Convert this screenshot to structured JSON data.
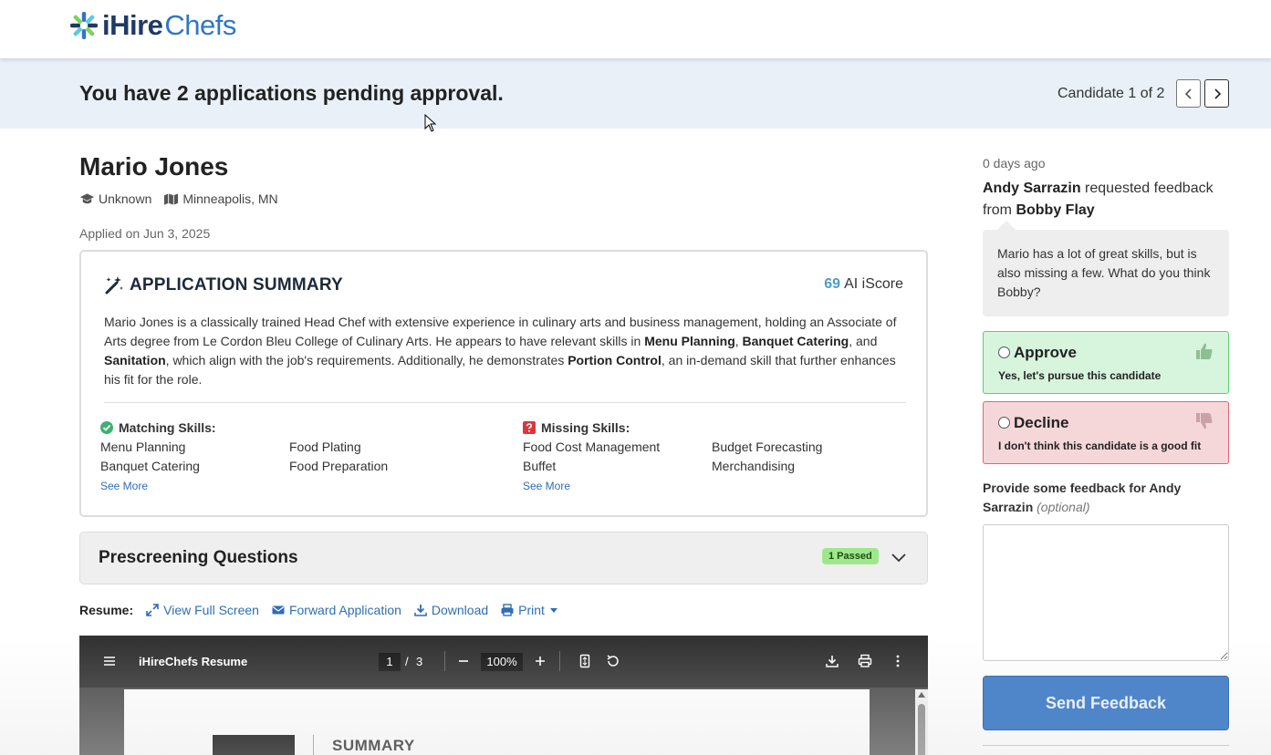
{
  "header": {
    "logo_i": "iHire",
    "logo_chefs": "Chefs"
  },
  "pending": {
    "title": "You have 2 applications pending approval.",
    "candidate_count": "Candidate 1 of 2"
  },
  "candidate": {
    "name": "Mario Jones",
    "education": "Unknown",
    "location": "Minneapolis, MN",
    "applied": "Applied on Jun 3, 2025"
  },
  "summary": {
    "title": "APPLICATION SUMMARY",
    "score": "69",
    "score_label": "AI iScore",
    "text_parts": [
      "Mario Jones is a classically trained Head Chef with extensive experience in culinary arts and business management, holding an Associate of Arts degree from Le Cordon Bleu College of Culinary Arts. He appears to have relevant skills in ",
      "Menu Planning",
      ", ",
      "Banquet Catering",
      ", and ",
      "Sanitation",
      ", which align with the job's requirements. Additionally, he demonstrates ",
      "Portion Control",
      ", an in-demand skill that further enhances his fit for the role."
    ],
    "matching_label": "Matching Skills:",
    "matching_skills": [
      "Menu Planning",
      "Food Plating",
      "Banquet Catering",
      "Food Preparation"
    ],
    "missing_label": "Missing Skills:",
    "missing_skills": [
      "Food Cost Management",
      "Budget Forecasting",
      "Buffet",
      "Merchandising"
    ],
    "see_more": "See More",
    "colors": {
      "match": "#3cb371",
      "miss": "#d9363e",
      "score": "#4a9fc8"
    }
  },
  "prescreen": {
    "title": "Prescreening Questions",
    "badge": "1 Passed"
  },
  "resume": {
    "label": "Resume:",
    "view_full": "View Full Screen",
    "forward": "Forward Application",
    "download": "Download",
    "print": "Print"
  },
  "pdf": {
    "title": "iHireChefs Resume",
    "page": "1",
    "separator": "/",
    "total": "3",
    "zoom": "100%",
    "section": "SUMMARY"
  },
  "feedback": {
    "time": "0 days ago",
    "requester": "Andy Sarrazin",
    "requested_text": " requested feedback from ",
    "reviewer": "Bobby Flay",
    "message": "Mario has a lot of great skills, but is also missing a few. What do you think Bobby?",
    "approve_title": "Approve",
    "approve_sub": "Yes, let's pursue this candidate",
    "decline_title": "Decline",
    "decline_sub": "I don't think this candidate is a good fit",
    "label_main": "Provide some feedback for Andy Sarrazin ",
    "label_optional": "(optional)",
    "textarea_value": "",
    "send": "Send Feedback"
  }
}
